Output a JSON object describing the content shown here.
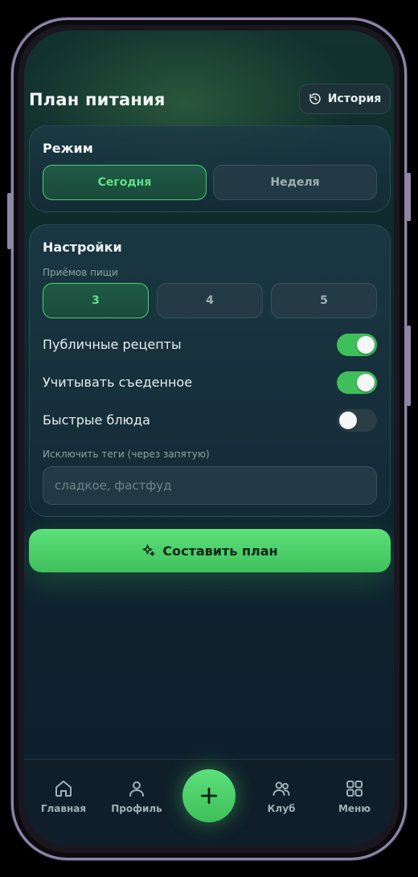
{
  "header": {
    "title": "План питания",
    "history_label": "История"
  },
  "mode": {
    "title": "Режим",
    "options": [
      "Сегодня",
      "Неделя"
    ],
    "selected": "Сегодня"
  },
  "settings": {
    "title": "Настройки",
    "meals_label": "Приёмов пищи",
    "meal_options": [
      "3",
      "4",
      "5"
    ],
    "meal_selected": "3",
    "toggles": [
      {
        "label": "Публичные рецепты",
        "on": true
      },
      {
        "label": "Учитывать съеденное",
        "on": true
      },
      {
        "label": "Быстрые блюда",
        "on": false
      }
    ],
    "exclude_label": "Исключить теги (через запятую)",
    "exclude_placeholder": "сладкое, фастфуд",
    "exclude_value": ""
  },
  "action": {
    "label": "Составить план",
    "icon": "sparkle-icon"
  },
  "tabbar": {
    "items": [
      {
        "label": "Главная",
        "icon": "home-icon"
      },
      {
        "label": "Профиль",
        "icon": "user-icon"
      },
      {
        "label": "Клуб",
        "icon": "users-icon"
      },
      {
        "label": "Меню",
        "icon": "grid-icon"
      }
    ],
    "fab_icon": "plus-icon"
  },
  "colors": {
    "accent": "#4ecf73",
    "background": "#0f2430"
  }
}
